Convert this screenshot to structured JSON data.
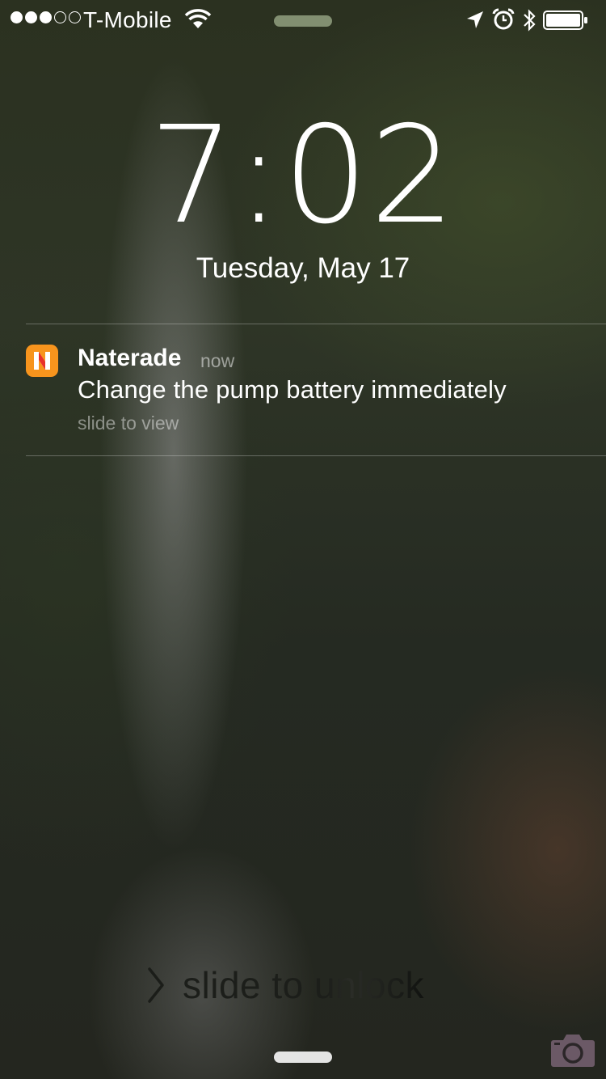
{
  "status_bar": {
    "signal_bars_filled": 3,
    "signal_bars_total": 5,
    "carrier": "T-Mobile",
    "icons": [
      "wifi-icon",
      "location-arrow-icon",
      "alarm-icon",
      "bluetooth-icon",
      "battery-icon"
    ],
    "battery_level_percent": 100
  },
  "lock_screen": {
    "time": "7:02",
    "date": "Tuesday, May 17"
  },
  "notification": {
    "app_name": "Naterade",
    "app_icon_letter": "N",
    "app_icon_color": "#f7941d",
    "time": "now",
    "message": "Change the pump battery immediately",
    "hint": "slide to view"
  },
  "unlock": {
    "label": "slide to unlock",
    "icons": [
      "chevron-right-icon",
      "camera-icon"
    ]
  }
}
